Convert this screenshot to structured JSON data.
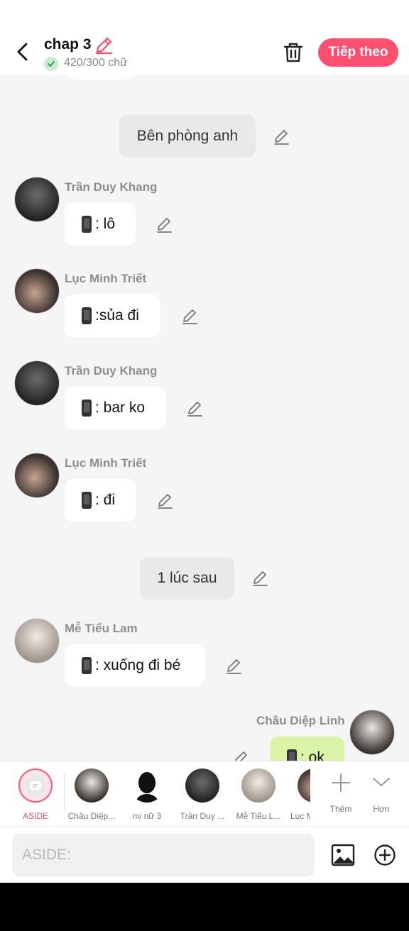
{
  "header": {
    "title": "chap 3",
    "word_count": "420/300 chữ",
    "next_label": "Tiếp theo"
  },
  "messages": {
    "narration_1": "Bên phòng anh",
    "m1": {
      "speaker": "Trần Duy Khang",
      "text": ": lô"
    },
    "m2": {
      "speaker": "Lục Minh Triết",
      "text": ":sủa đi"
    },
    "m3": {
      "speaker": "Trần Duy Khang",
      "text": ": bar ko"
    },
    "m4": {
      "speaker": "Lục Minh Triết",
      "text": ": đi"
    },
    "narration_2": "1 lúc sau",
    "m5": {
      "speaker": "Mễ Tiểu Lam",
      "text": ": xuống đi bé"
    },
    "m6": {
      "speaker": "Châu Diệp Linh",
      "text": ": ok"
    }
  },
  "characters": [
    {
      "label": "ASIDE"
    },
    {
      "label": "Châu Diệp..."
    },
    {
      "label": "nv nữ 3"
    },
    {
      "label": "Trần Duy ..."
    },
    {
      "label": "Mễ Tiểu L..."
    },
    {
      "label": "Lục M"
    }
  ],
  "actions": {
    "more_label": "Thêm",
    "expand_label": "Hơn"
  },
  "input": {
    "placeholder": "ASIDE:"
  },
  "colors": {
    "accent": "#ff4f6e",
    "own_bubble": "#d9f3a7",
    "aside_active": "#ff5a75"
  }
}
